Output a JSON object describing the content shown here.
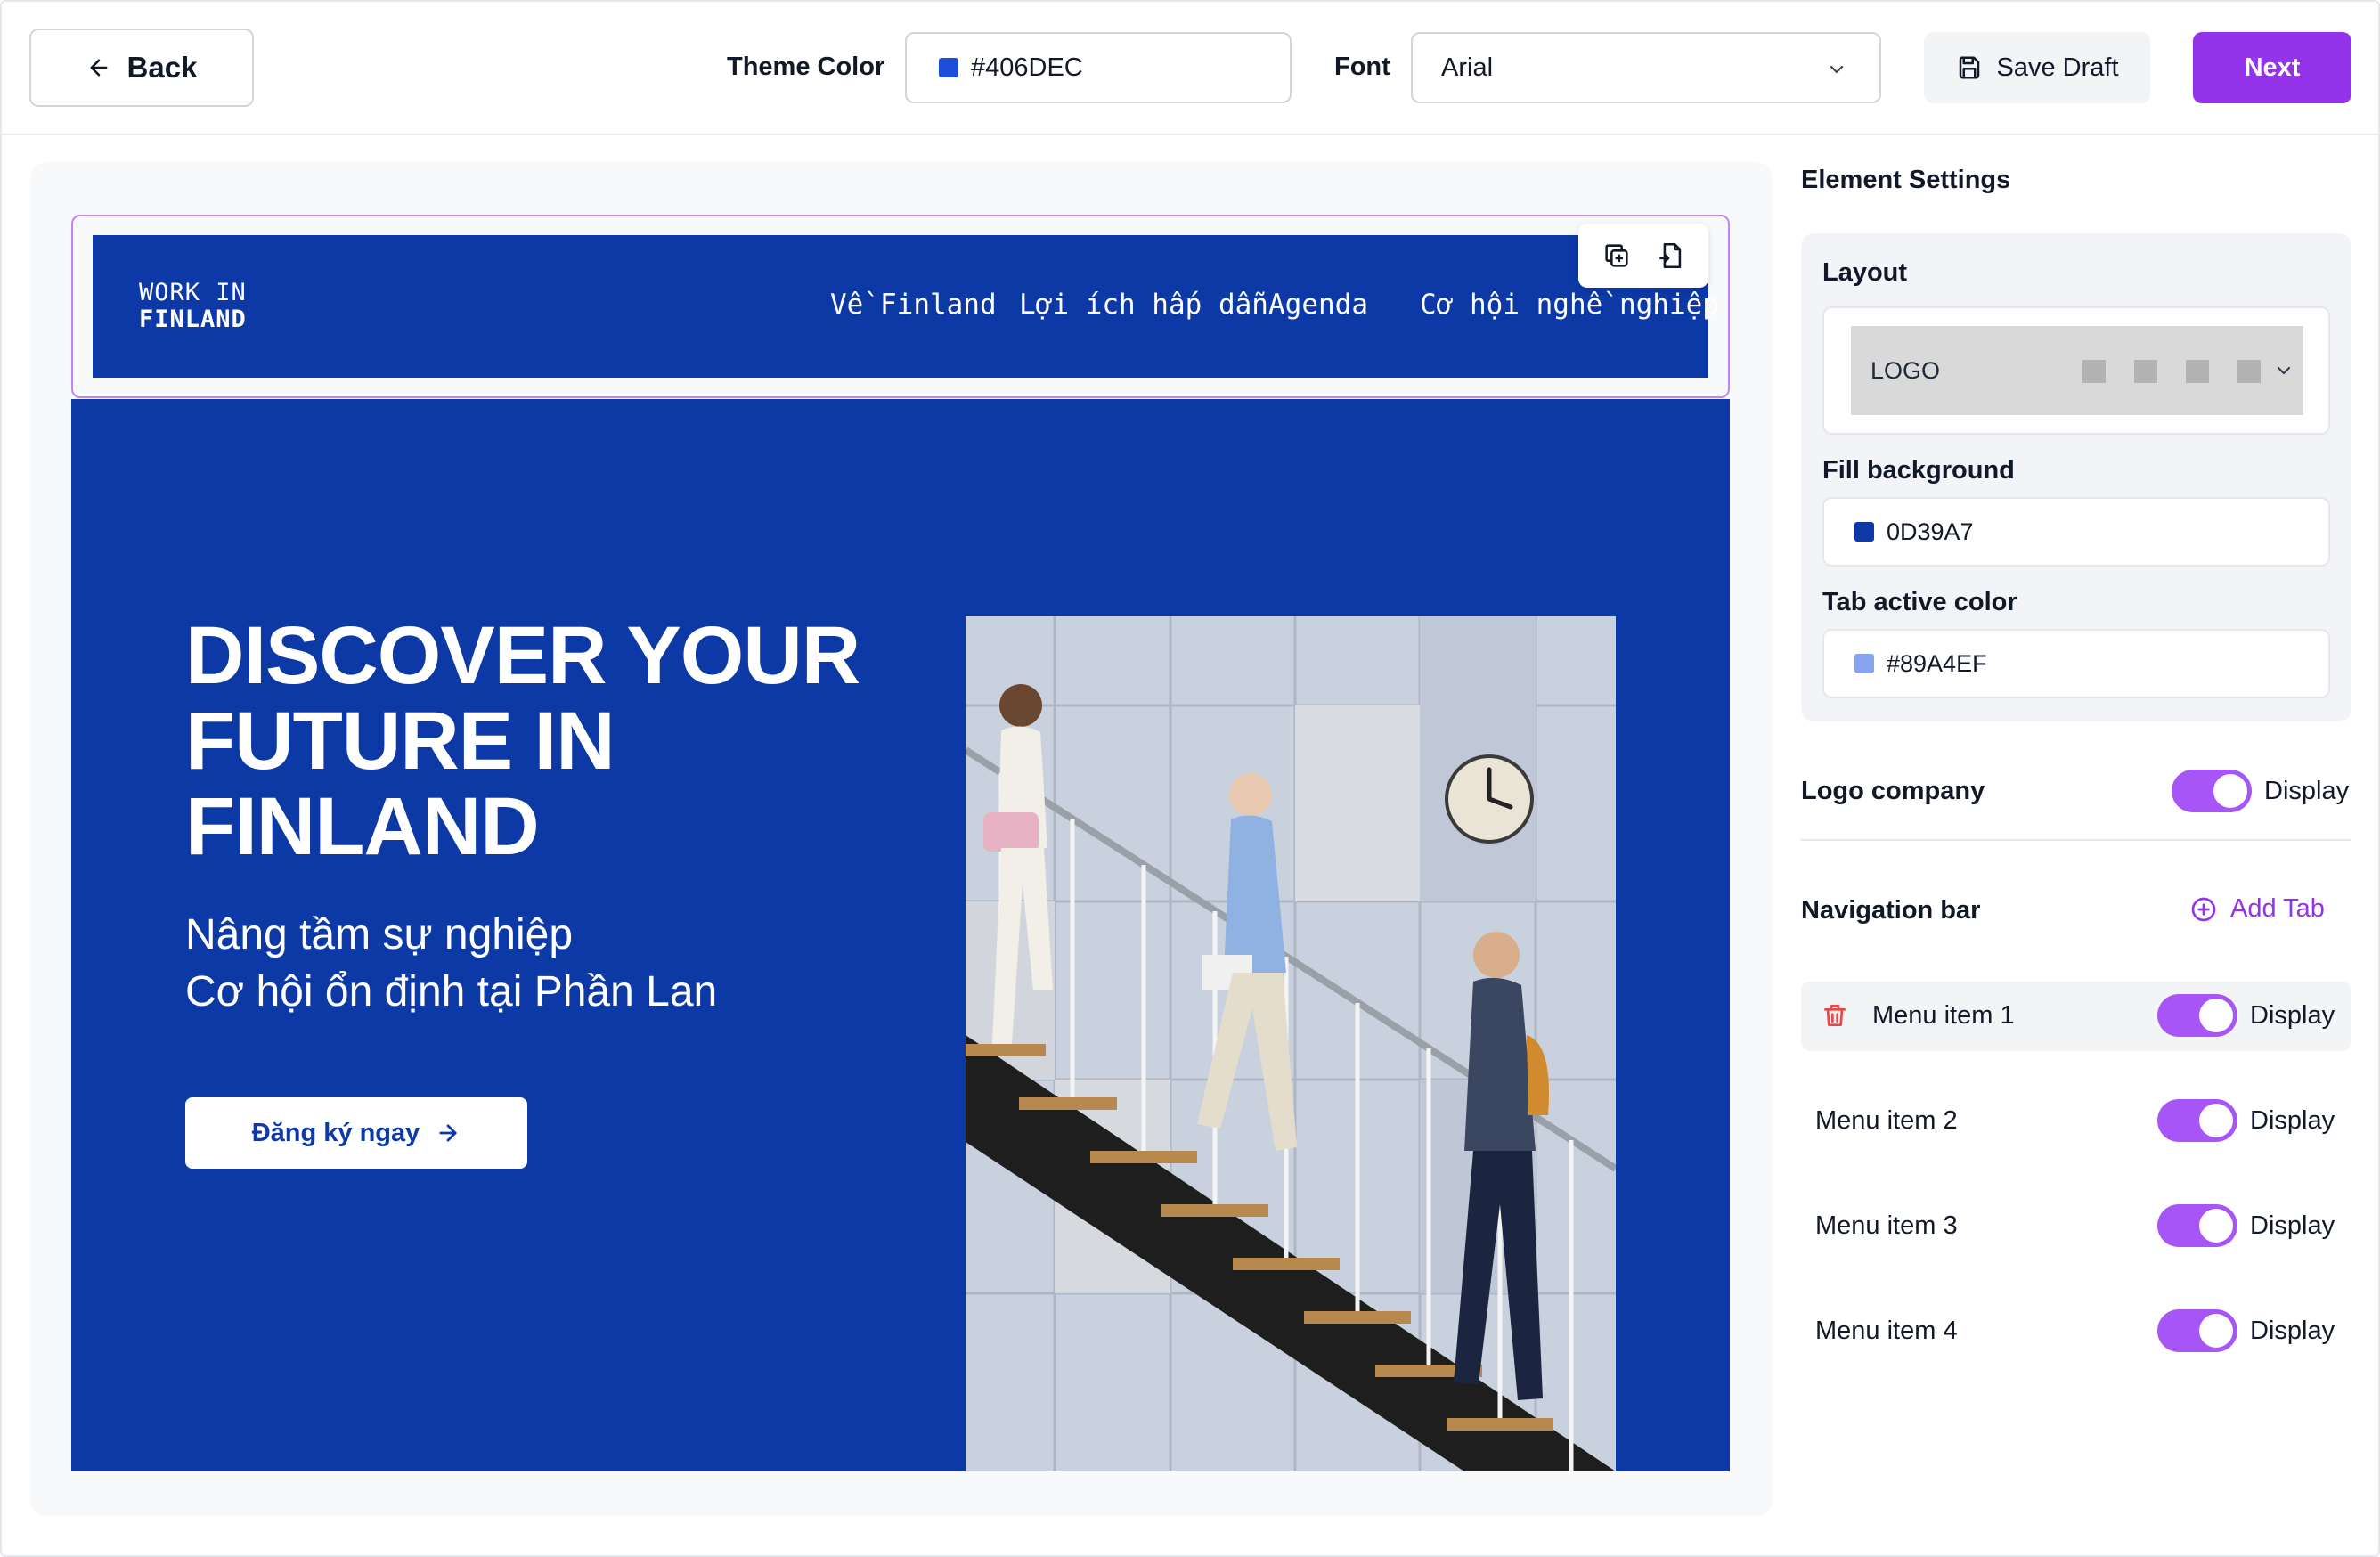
{
  "toolbar": {
    "back_label": "Back",
    "theme_color_label": "Theme Color",
    "theme_color_value": "#406DEC",
    "font_label": "Font",
    "font_value": "Arial",
    "save_label": "Save Draft",
    "next_label": "Next"
  },
  "preview": {
    "logo_line1": "WORK IN",
    "logo_line2": "FINLAND",
    "nav_items": [
      "Về Finland",
      "Lợi ích hấp dẫn",
      "Agenda",
      "Cơ hội nghề nghiệp"
    ],
    "hero_title": "DISCOVER YOUR FUTURE IN FINLAND",
    "hero_sub_1": "Nâng tầm sự nghiệp",
    "hero_sub_2": "Cơ hội ổn định tại Phần Lan",
    "hero_button": "Đăng ký ngay"
  },
  "settings": {
    "title": "Element Settings",
    "layout_label": "Layout",
    "layout_value": "LOGO",
    "fill_label": "Fill background",
    "fill_value": "0D39A7",
    "tab_active_label": "Tab active color",
    "tab_active_value": "#89A4EF",
    "logo_company_label": "Logo company",
    "display_label": "Display",
    "nav_bar_label": "Navigation bar",
    "add_tab_label": "Add Tab",
    "menu_items": [
      "Menu item 1",
      "Menu item 2",
      "Menu item 3",
      "Menu item 4"
    ]
  },
  "colors": {
    "brand_blue": "#0d39a7",
    "theme_swatch": "#1d4ed8",
    "tab_active_swatch": "#89A4EF",
    "accent_purple": "#9333ea",
    "toggle_purple": "#a855f7"
  }
}
